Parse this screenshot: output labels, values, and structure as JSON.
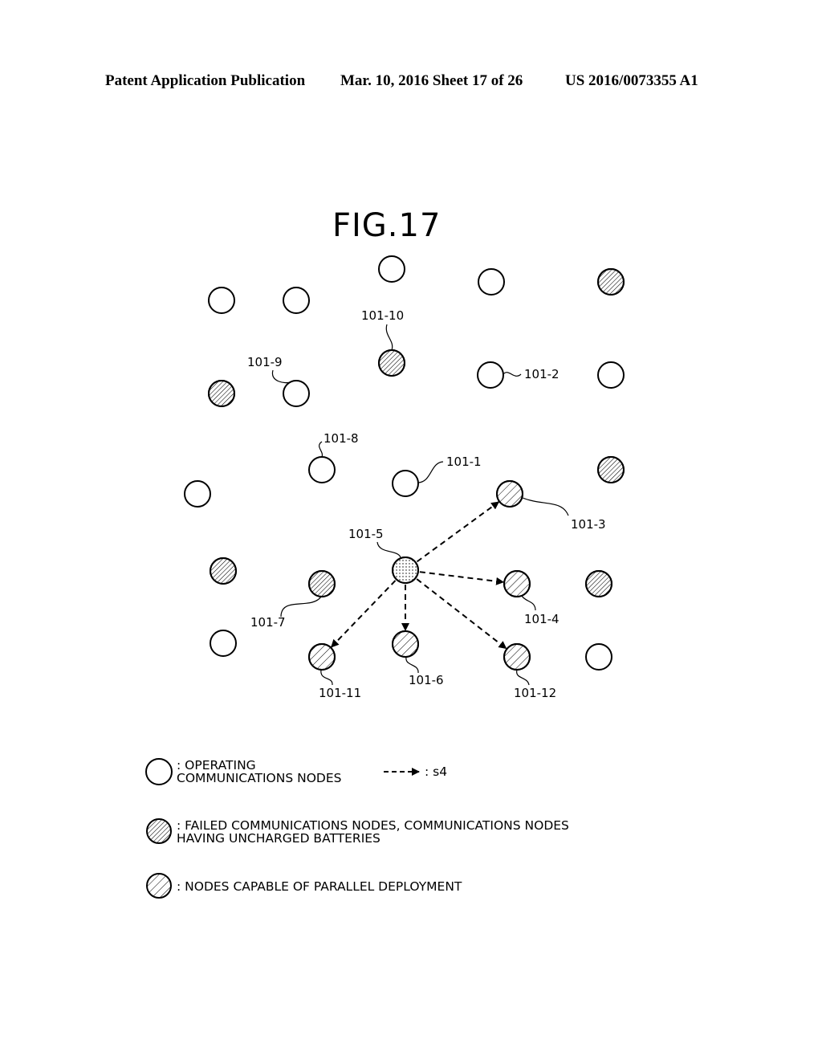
{
  "header": {
    "publication": "Patent Application Publication",
    "date_sheet": "Mar. 10, 2016  Sheet 17 of 26",
    "patent_number": "US 2016/0073355 A1"
  },
  "figure": {
    "title": "FIG.17",
    "node_types": {
      "operating": "operating communications node (open circle)",
      "failed": "failed / uncharged node (dense hatch)",
      "parallel": "node capable of parallel deployment (wide hatch)",
      "source": "deploying node (dotted)"
    },
    "nodes": [
      {
        "id": "n-top-1",
        "type": "operating",
        "label": ""
      },
      {
        "id": "n-top-2",
        "type": "operating",
        "label": ""
      },
      {
        "id": "n-top-3",
        "type": "failed",
        "label": ""
      },
      {
        "id": "n-r2-1",
        "type": "operating",
        "label": ""
      },
      {
        "id": "n-r2-2",
        "type": "operating",
        "label": ""
      },
      {
        "id": "101-10",
        "type": "failed",
        "label": "101-10"
      },
      {
        "id": "n-r3-1",
        "type": "failed",
        "label": ""
      },
      {
        "id": "101-9",
        "type": "operating",
        "label": "101-9"
      },
      {
        "id": "101-2",
        "type": "operating",
        "label": "101-2"
      },
      {
        "id": "n-r3-5",
        "type": "operating",
        "label": ""
      },
      {
        "id": "101-8",
        "type": "operating",
        "label": "101-8"
      },
      {
        "id": "101-1",
        "type": "operating",
        "label": "101-1"
      },
      {
        "id": "n-r4-3",
        "type": "failed",
        "label": ""
      },
      {
        "id": "n-r4-4",
        "type": "operating",
        "label": ""
      },
      {
        "id": "101-3",
        "type": "parallel",
        "label": "101-3"
      },
      {
        "id": "101-5",
        "type": "source",
        "label": "101-5"
      },
      {
        "id": "n-r5-2",
        "type": "failed",
        "label": ""
      },
      {
        "id": "101-7",
        "type": "failed",
        "label": "101-7"
      },
      {
        "id": "101-4",
        "type": "parallel",
        "label": "101-4"
      },
      {
        "id": "n-r5-5",
        "type": "failed",
        "label": ""
      },
      {
        "id": "n-r6-1",
        "type": "operating",
        "label": ""
      },
      {
        "id": "101-11",
        "type": "parallel",
        "label": "101-11"
      },
      {
        "id": "101-6",
        "type": "parallel",
        "label": "101-6"
      },
      {
        "id": "101-12",
        "type": "parallel",
        "label": "101-12"
      },
      {
        "id": "n-r6-5",
        "type": "operating",
        "label": ""
      }
    ],
    "arrows": [
      {
        "from": "101-5",
        "to": "101-3",
        "label": "s4"
      },
      {
        "from": "101-5",
        "to": "101-4",
        "label": "s4"
      },
      {
        "from": "101-5",
        "to": "101-12",
        "label": "s4"
      },
      {
        "from": "101-5",
        "to": "101-6",
        "label": "s4"
      },
      {
        "from": "101-5",
        "to": "101-11",
        "label": "s4"
      }
    ]
  },
  "legend": {
    "operating_line1": ": OPERATING",
    "operating_line2": "COMMUNICATIONS NODES",
    "arrow_label": ": s4",
    "failed_line1": ": FAILED COMMUNICATIONS NODES, COMMUNICATIONS NODES",
    "failed_line2": "HAVING UNCHARGED BATTERIES",
    "parallel": ": NODES CAPABLE OF PARALLEL DEPLOYMENT"
  }
}
